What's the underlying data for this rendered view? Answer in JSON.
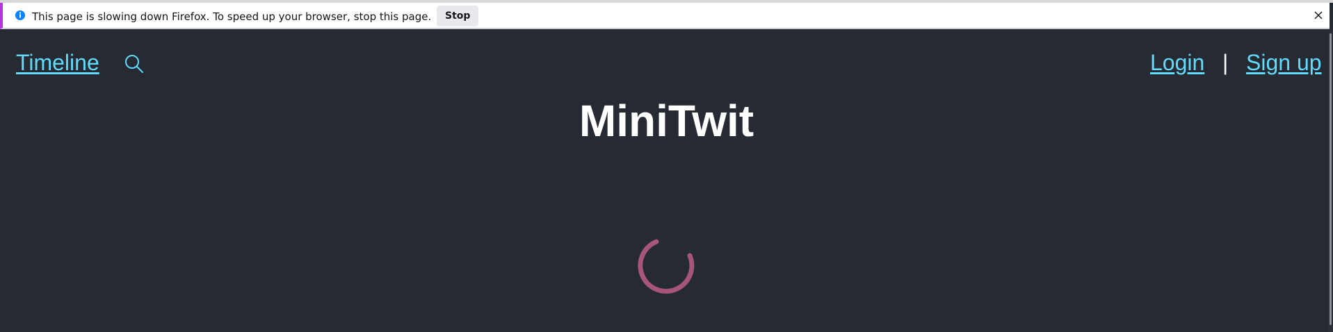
{
  "notification": {
    "message": "This page is slowing down Firefox. To speed up your browser, stop this page.",
    "stop_label": "Stop",
    "info_icon": "info-icon",
    "close_icon": "close-icon",
    "accent_color": "#b833e1"
  },
  "nav": {
    "timeline_label": "Timeline",
    "search_icon": "search-icon",
    "login_label": "Login",
    "separator": "|",
    "signup_label": "Sign up",
    "link_color": "#61dafb"
  },
  "main": {
    "title": "MiniTwit",
    "spinner_color": "#a8557b",
    "background_color": "#262a33"
  }
}
